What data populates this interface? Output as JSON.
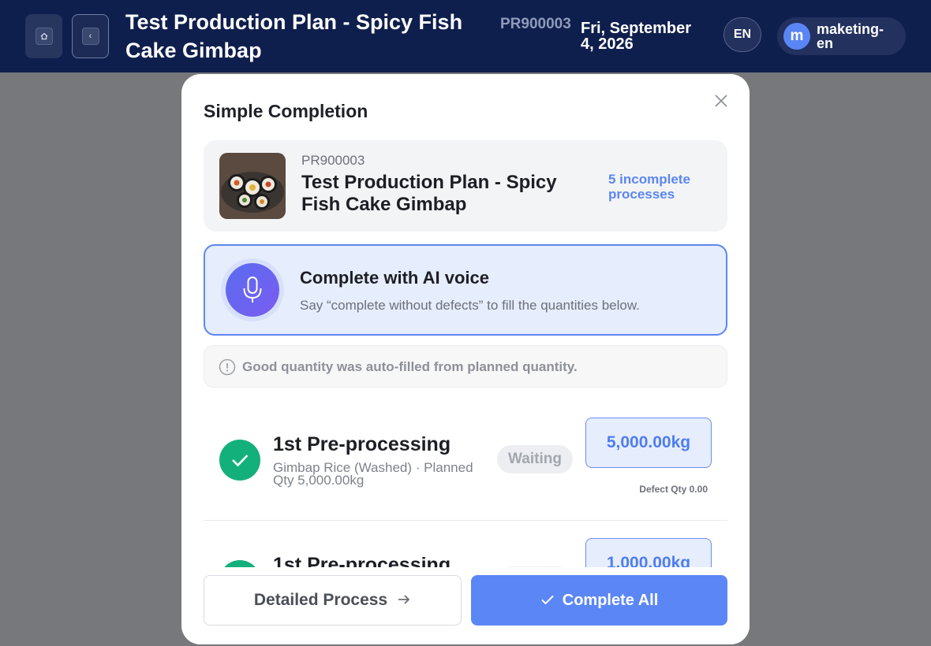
{
  "header": {
    "title": "Test Production Plan - Spicy Fish Cake Gimbap",
    "plan_code": "PR900003",
    "date": "Fri, September 4, 2026",
    "language": "EN",
    "user_initial": "m",
    "username": "maketing-en"
  },
  "modal": {
    "title": "Simple Completion",
    "plan": {
      "code": "PR900003",
      "name": "Test Production Plan - Spicy Fish Cake Gimbap",
      "incomplete": "5 incomplete processes"
    },
    "ai_voice": {
      "title": "Complete with AI voice",
      "subtitle": "Say “complete without defects” to fill the quantities below."
    },
    "notice": "Good quantity was auto-filled from planned quantity.",
    "processes": [
      {
        "title": "1st Pre-processing",
        "subtitle": "Gimbap Rice (Washed) · Planned Qty 5,000.00kg",
        "status": "Waiting",
        "quantity": "5,000.00kg",
        "defect": "Defect Qty 0.00"
      },
      {
        "title": "1st Pre-processing",
        "quantity": "1,000.00kg"
      }
    ],
    "buttons": {
      "detailed": "Detailed Process",
      "complete_all": "Complete All"
    }
  },
  "colors": {
    "header_bg": "#0f1f4d",
    "accent": "#5b86f5",
    "success": "#14b07b"
  }
}
